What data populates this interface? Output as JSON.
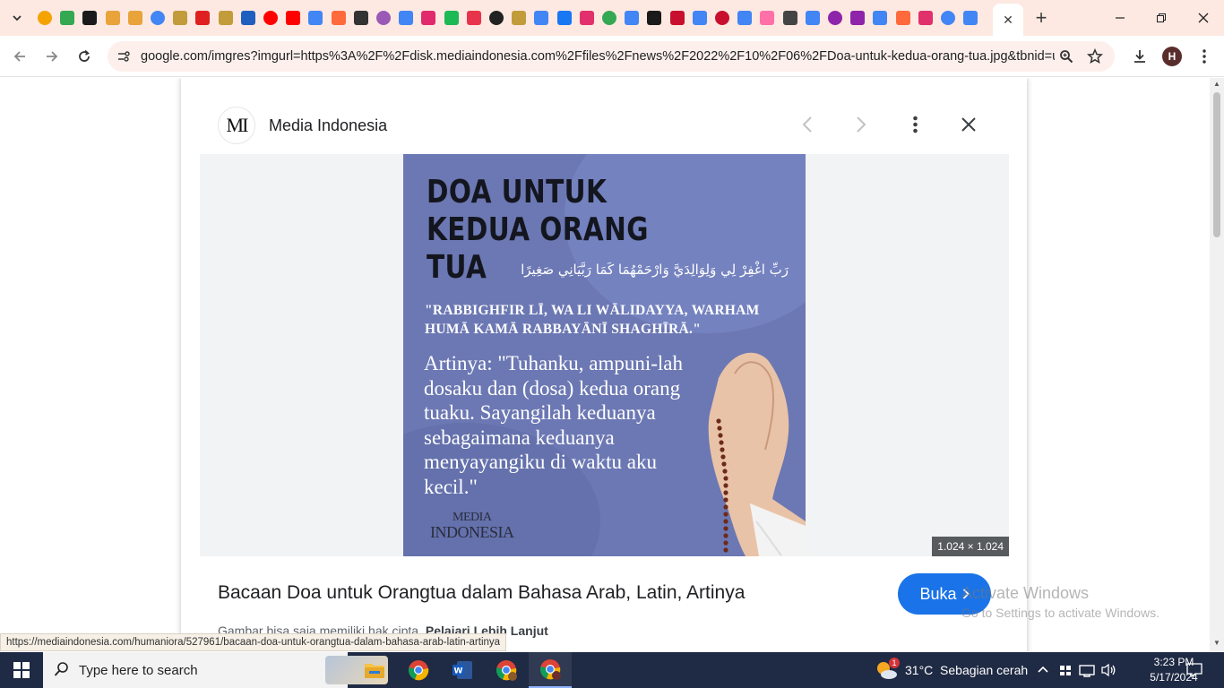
{
  "browser": {
    "active_tab_close": "✕",
    "new_tab": "+",
    "window_controls": [
      "minimize",
      "restore",
      "close"
    ],
    "url": "google.com/imgres?imgurl=https%3A%2F%2Fdisk.mediaindonesia.com%2Ffiles%2Fnews%2F2022%2F10%2F06%2FDoa-untuk-kedua-orang-tua.jpg&tbnid=uXgoo...",
    "profile_initial": "H",
    "tab_favicon_colors": [
      "#f4a300",
      "#34a853",
      "#1a1a1a",
      "#e8a33a",
      "#e8a33a",
      "#4285f4",
      "#c29b3a",
      "#e02020",
      "#c29b3a",
      "#1f5fbf",
      "#ff0000",
      "#ff0000",
      "#4285f4",
      "#ff6a3d",
      "#333333",
      "#9b59b6",
      "#4285f4",
      "#e02a6b",
      "#1db954",
      "#e8344a",
      "#222222",
      "#c29b3a",
      "#4285f4",
      "#1877f2",
      "#e1306c",
      "#34a853",
      "#4285f4",
      "#1a1a1a",
      "#c8102e",
      "#4285f4",
      "#c8102e",
      "#4285f4",
      "#ff6fa8",
      "#444444",
      "#4285f4",
      "#8e24aa",
      "#8e24aa",
      "#4285f4",
      "#ff6a3d",
      "#e1306c",
      "#4285f4",
      "#4285f4"
    ]
  },
  "panel": {
    "source_logo": "MI",
    "source_name": "Media Indonesia",
    "dimensions": "1.024 × 1.024",
    "caption": "Bacaan Doa untuk Orangtua dalam Bahasa Arab, Latin, Artinya",
    "open_label": "Buka",
    "copyright_text": "Gambar bisa saja memiliki hak cipta.",
    "learn_more": "Pelajari Lebih Lanjut"
  },
  "poster": {
    "title": "DOA UNTUK KEDUA ORANG TUA",
    "arabic": "رَبِّ اغْفِرْ لِي وَلِوَالِدَيَّ وَارْحَمْهُمَا كَمَا رَبَّيَانِي صَغِيرًا",
    "latin": "\"RABBIGHFIR LĪ, WA LI WĀLIDAYYA, WARHAM HUMĀ KAMĀ RABBAYĀNĪ SHAGHĪRĀ.\"",
    "meaning": "Artinya: \"Tuhanku, ampuni-lah dosaku dan (dosa) kedua orang tuaku. Sayangilah keduanya sebagaimana keduanya menyayangiku di waktu aku kecil.\"",
    "brand_line1": "MEDIA",
    "brand_line2": "INDONESIA"
  },
  "windows_watermark": {
    "line1": "Activate Windows",
    "line2": "Go to Settings to activate Windows."
  },
  "status_link": "https://mediaindonesia.com/humaniora/527961/bacaan-doa-untuk-orangtua-dalam-bahasa-arab-latin-artinya",
  "taskbar": {
    "search_placeholder": "Type here to search",
    "weather": "31°C  Sebagian cerah",
    "weather_badge": "1",
    "time": "3:23 PM",
    "date": "5/17/2024"
  }
}
